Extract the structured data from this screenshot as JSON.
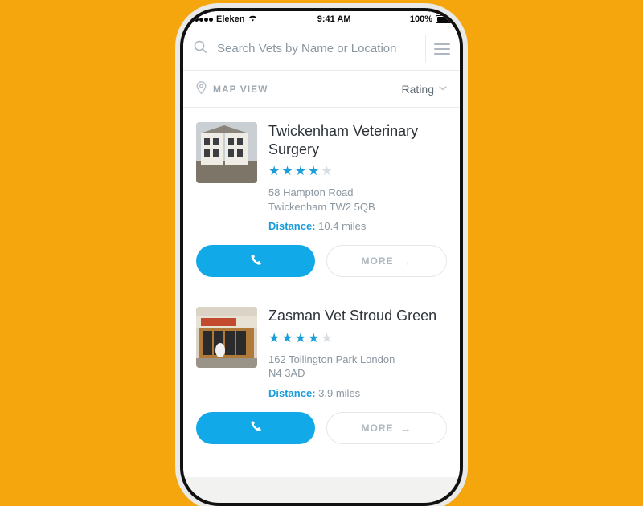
{
  "statusbar": {
    "carrier": "Eleken",
    "time": "9:41 AM",
    "battery_pct": "100%"
  },
  "search": {
    "placeholder": "Search Vets by Name or Location"
  },
  "filter": {
    "map_view_label": "MAP VIEW",
    "sort_label": "Rating"
  },
  "distance_label": "Distance:",
  "more_label": "MORE",
  "results": [
    {
      "name": "Twickenham Veterinary Surgery",
      "rating": 4,
      "address_line1": "58 Hampton Road",
      "address_line2": "Twickenham TW2 5QB",
      "distance": "10.4 miles"
    },
    {
      "name": "Zasman Vet Stroud Green",
      "rating": 4,
      "address_line1": "162 Tollington Park London",
      "address_line2": "N4 3AD",
      "distance": "3.9 miles"
    }
  ]
}
